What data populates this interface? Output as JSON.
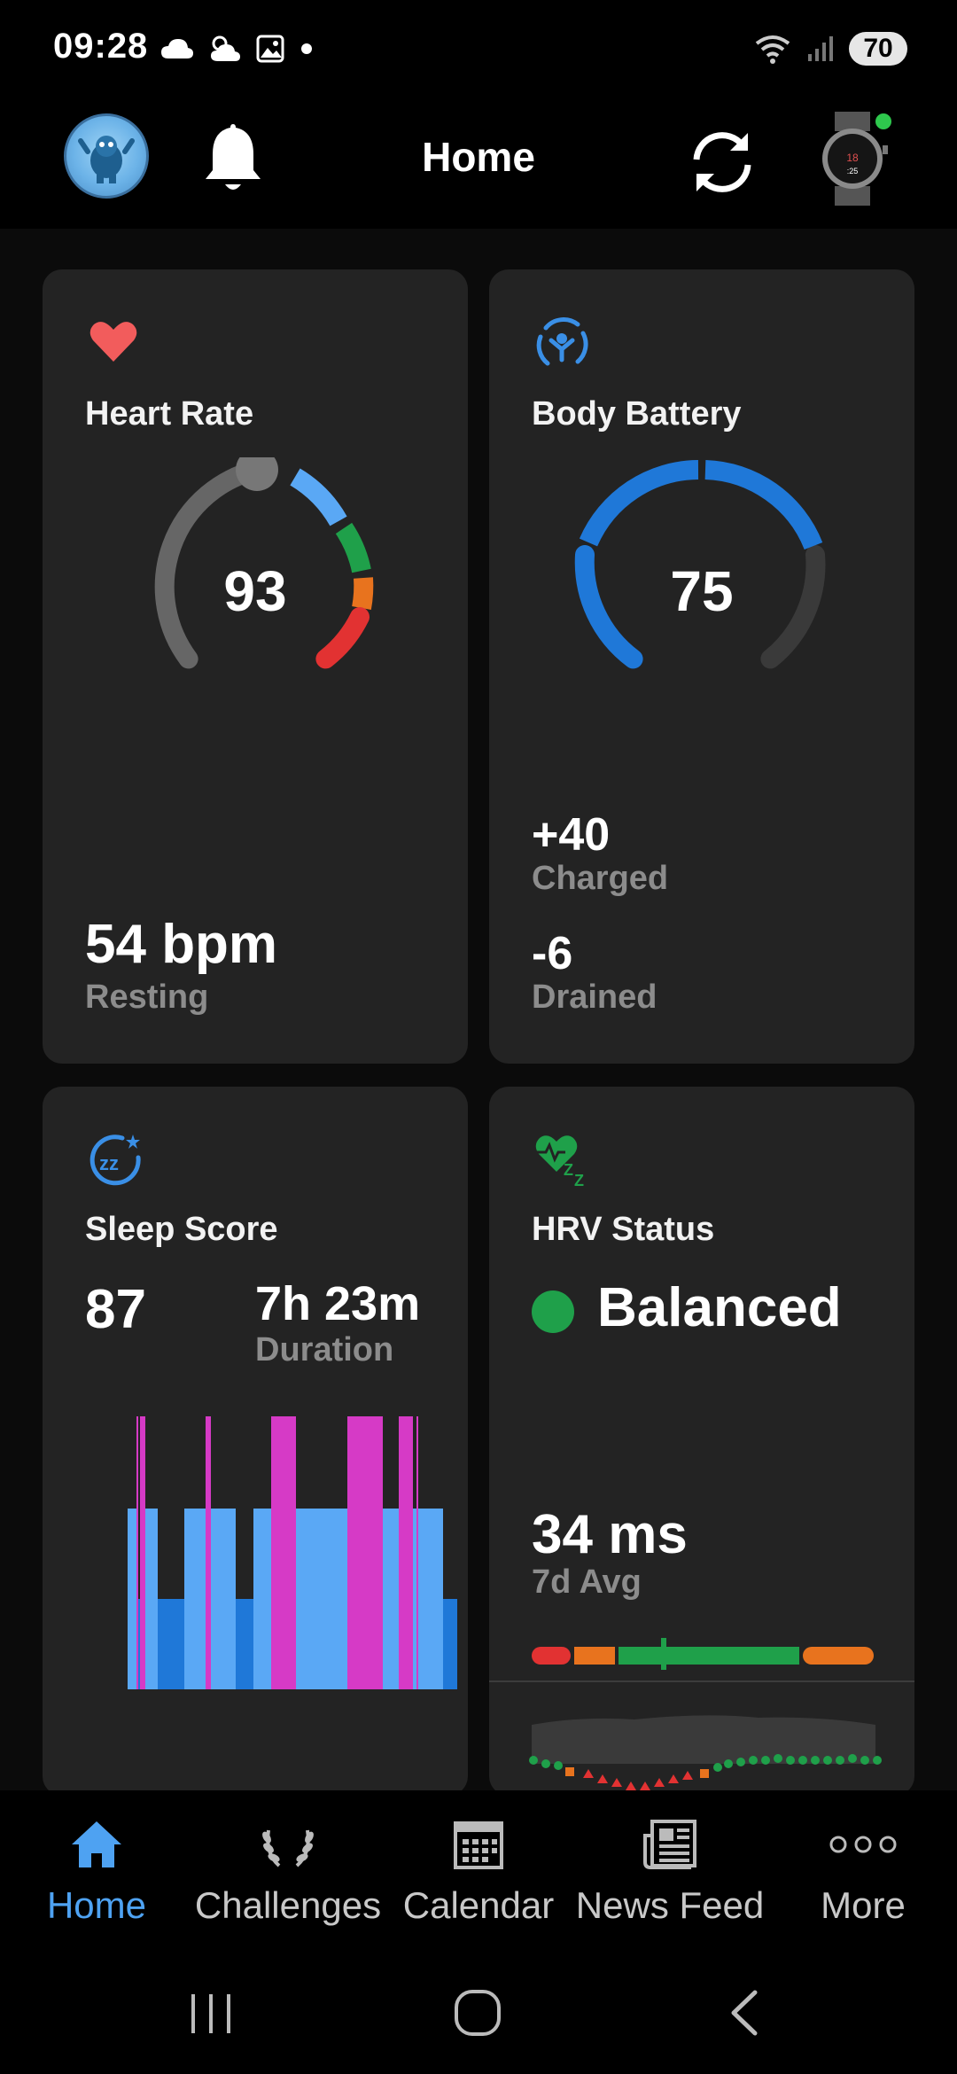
{
  "status_bar": {
    "time": "09:28",
    "battery": "70"
  },
  "header": {
    "title": "Home"
  },
  "cards": {
    "heart_rate": {
      "title": "Heart Rate",
      "current": "93",
      "resting_value": "54 bpm",
      "resting_label": "Resting"
    },
    "body_battery": {
      "title": "Body Battery",
      "current": "75",
      "charged_value": "+40",
      "charged_label": "Charged",
      "drained_value": "-6",
      "drained_label": "Drained"
    },
    "sleep_score": {
      "title": "Sleep Score",
      "score": "87",
      "duration_value": "7h 23m",
      "duration_label": "Duration"
    },
    "hrv_status": {
      "title": "HRV Status",
      "status": "Balanced",
      "avg_value": "34 ms",
      "avg_label": "7d Avg"
    }
  },
  "bottom_nav": [
    {
      "label": "Home",
      "icon": "home-icon",
      "active": true
    },
    {
      "label": "Challenges",
      "icon": "laurel-icon",
      "active": false
    },
    {
      "label": "Calendar",
      "icon": "calendar-icon",
      "active": false
    },
    {
      "label": "News Feed",
      "icon": "newspaper-icon",
      "active": false
    },
    {
      "label": "More",
      "icon": "more-icon",
      "active": false
    }
  ],
  "colors": {
    "accent": "#4ea2f2",
    "heart": "#f25c5c",
    "battery_blue": "#1f78d8",
    "hrv_green": "#1fa04a",
    "sleep_deep": "#1f78d8",
    "sleep_light": "#5aa8f5",
    "sleep_rem": "#d63ac6"
  }
}
